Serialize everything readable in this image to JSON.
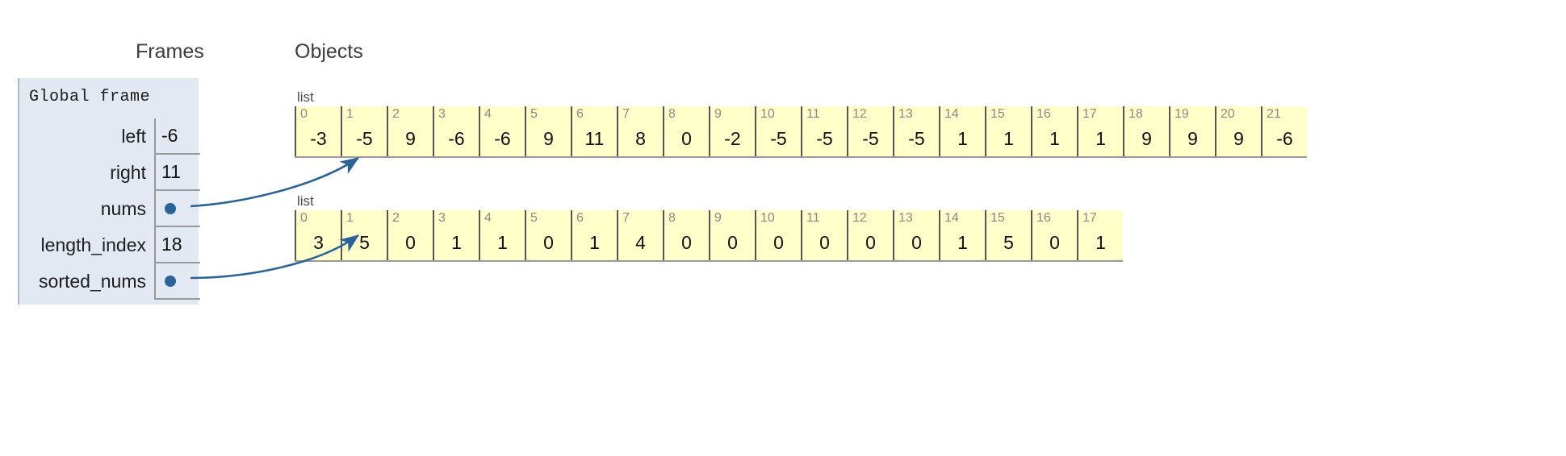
{
  "headings": {
    "frames": "Frames",
    "objects": "Objects"
  },
  "frame": {
    "title": "Global frame",
    "variables": [
      {
        "name": "left",
        "value": "-6",
        "is_pointer": false
      },
      {
        "name": "right",
        "value": "11",
        "is_pointer": false
      },
      {
        "name": "nums",
        "value": "",
        "is_pointer": true
      },
      {
        "name": "length_index",
        "value": "18",
        "is_pointer": false
      },
      {
        "name": "sorted_nums",
        "value": "",
        "is_pointer": true
      }
    ]
  },
  "objects": [
    {
      "id": "nums-list",
      "type_label": "list",
      "indices": [
        0,
        1,
        2,
        3,
        4,
        5,
        6,
        7,
        8,
        9,
        10,
        11,
        12,
        13,
        14,
        15,
        16,
        17,
        18,
        19,
        20,
        21
      ],
      "values": [
        "-3",
        "-5",
        "9",
        "-6",
        "-6",
        "9",
        "11",
        "8",
        "0",
        "-2",
        "-5",
        "-5",
        "-5",
        "-5",
        "1",
        "1",
        "1",
        "1",
        "9",
        "9",
        "9",
        "-6"
      ]
    },
    {
      "id": "sorted-nums-list",
      "type_label": "list",
      "indices": [
        0,
        1,
        2,
        3,
        4,
        5,
        6,
        7,
        8,
        9,
        10,
        11,
        12,
        13,
        14,
        15,
        16,
        17
      ],
      "values": [
        "3",
        "5",
        "0",
        "1",
        "1",
        "0",
        "1",
        "4",
        "0",
        "0",
        "0",
        "0",
        "0",
        "0",
        "1",
        "5",
        "0",
        "1"
      ]
    }
  ],
  "colors": {
    "frame_background": "#e2e9f3",
    "list_cell_background": "#ffffc9",
    "pointer": "#2a6496",
    "cell_border": "#555555",
    "index_text": "#8a8a8a"
  },
  "arrows": [
    {
      "from": "nums",
      "to": "nums-list"
    },
    {
      "from": "sorted_nums",
      "to": "sorted-nums-list"
    }
  ]
}
